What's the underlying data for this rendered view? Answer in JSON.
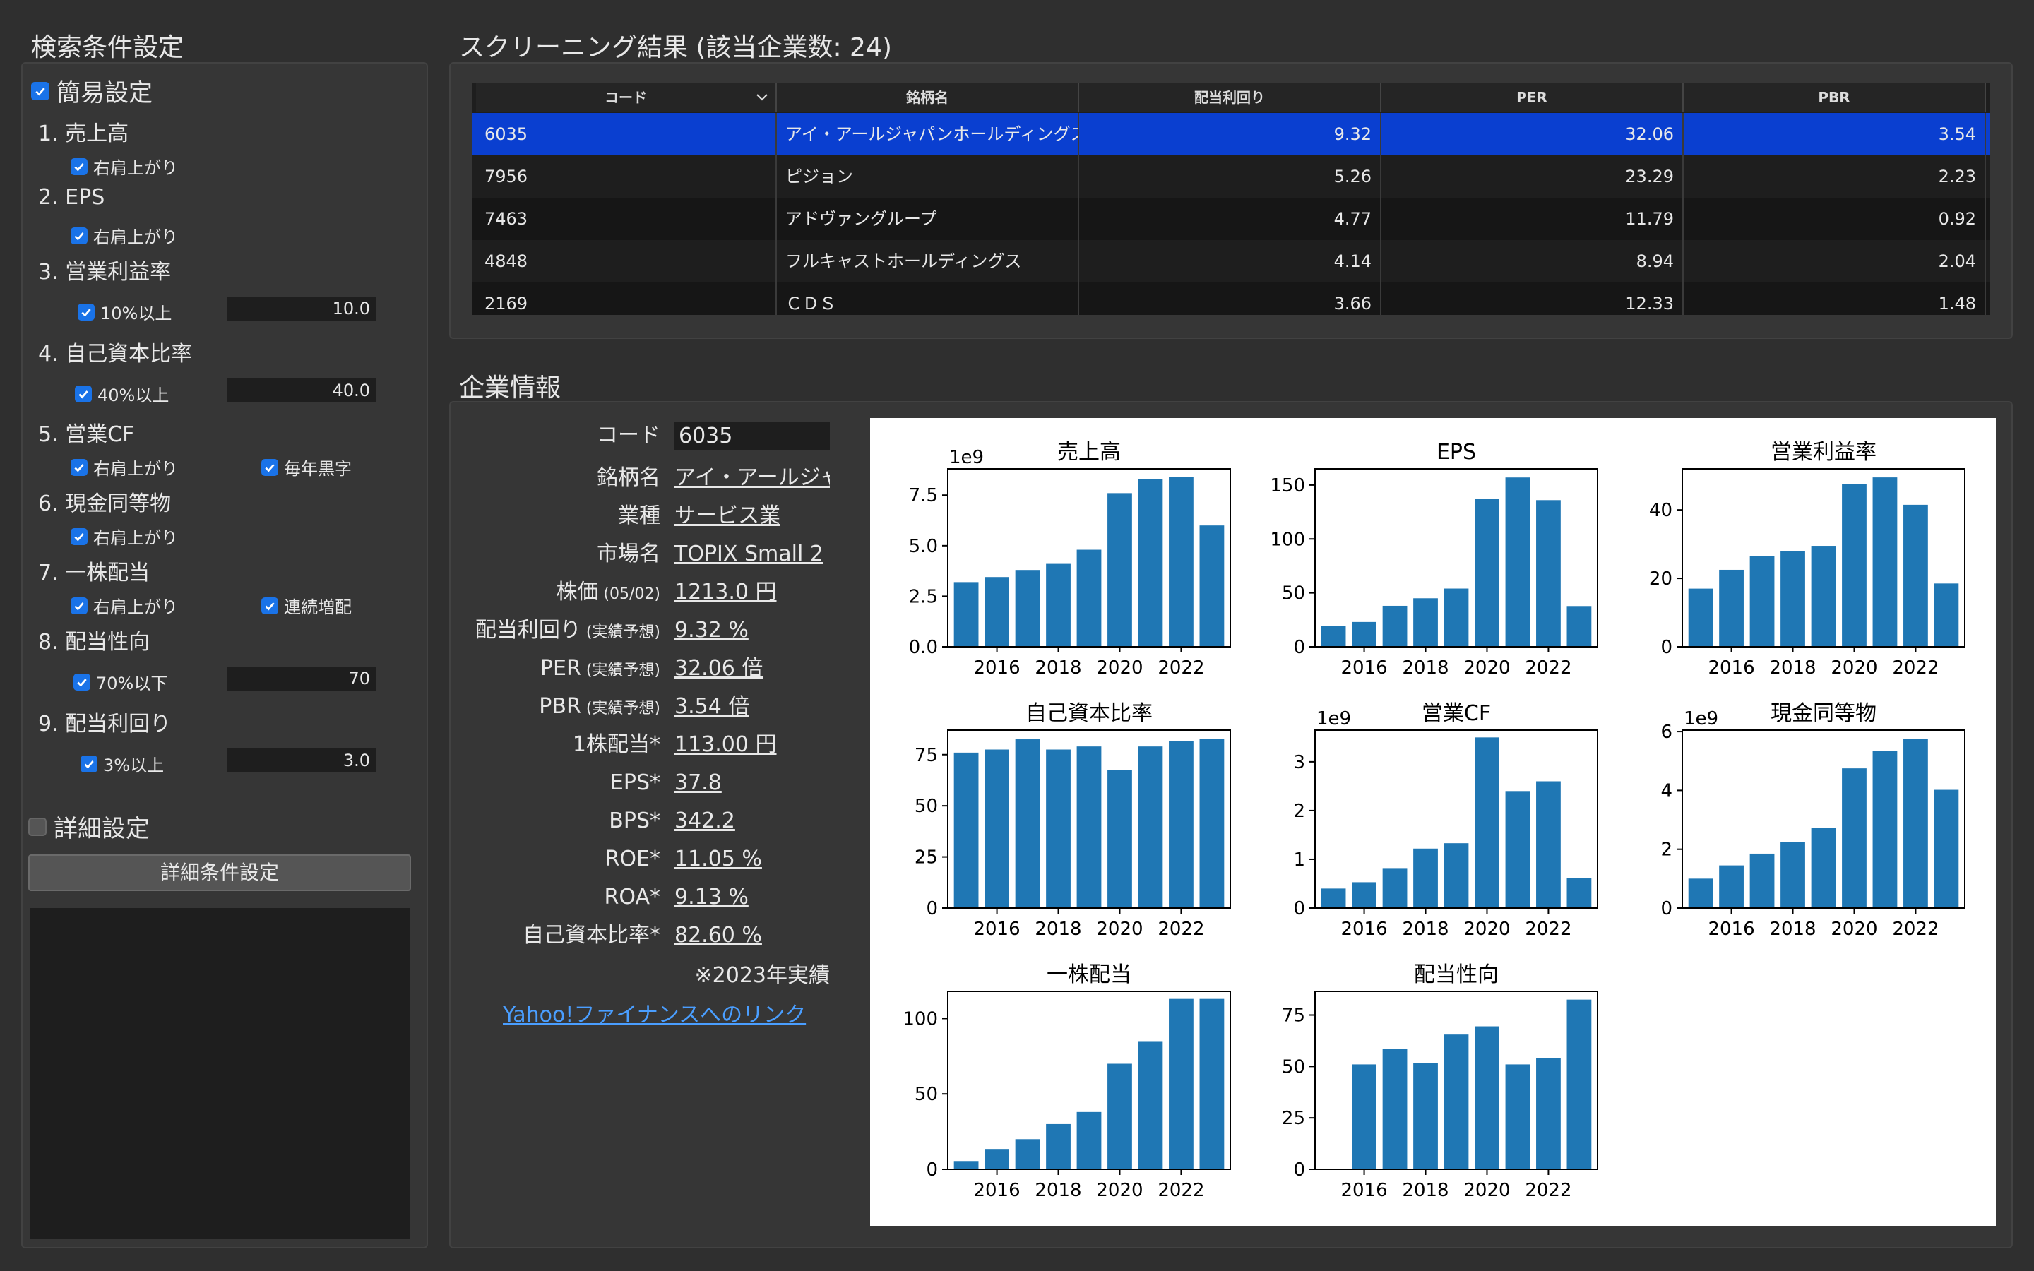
{
  "left": {
    "title": "検索条件設定",
    "simple": {
      "label": "簡易設定",
      "checked": true
    },
    "items": [
      {
        "head": "1. 売上高",
        "checks": [
          {
            "label": "右肩上がり"
          }
        ]
      },
      {
        "head": "2. EPS",
        "checks": [
          {
            "label": "右肩上がり"
          }
        ]
      },
      {
        "head": "3. 営業利益率",
        "checks": [
          {
            "label": "10%以上"
          }
        ],
        "value": "10.0"
      },
      {
        "head": "4. 自己資本比率",
        "checks": [
          {
            "label": "40%以上"
          }
        ],
        "value": "40.0"
      },
      {
        "head": "5. 営業CF",
        "checks": [
          {
            "label": "右肩上がり"
          },
          {
            "label": "毎年黒字"
          }
        ]
      },
      {
        "head": "6. 現金同等物",
        "checks": [
          {
            "label": "右肩上がり"
          }
        ]
      },
      {
        "head": "7. 一株配当",
        "checks": [
          {
            "label": "右肩上がり"
          },
          {
            "label": "連続増配"
          }
        ]
      },
      {
        "head": "8. 配当性向",
        "checks": [
          {
            "label": "70%以下"
          }
        ],
        "value": "70"
      },
      {
        "head": "9. 配当利回り",
        "checks": [
          {
            "label": "3%以上"
          }
        ],
        "value": "3.0"
      }
    ],
    "detail": {
      "label": "詳細設定",
      "checked": false
    },
    "detail_button": "詳細条件設定"
  },
  "results": {
    "title": "スクリーニング結果 (該当企業数: 24)",
    "columns": [
      "コード",
      "銘柄名",
      "配当利回り",
      "PER",
      "PBR"
    ],
    "rows": [
      [
        "6035",
        "アイ・アールジャパンホールディングス",
        "9.32",
        "32.06",
        "3.54"
      ],
      [
        "7956",
        "ピジョン",
        "5.26",
        "23.29",
        "2.23"
      ],
      [
        "7463",
        "アドヴァングループ",
        "4.77",
        "11.79",
        "0.92"
      ],
      [
        "4848",
        "フルキャストホールディングス",
        "4.14",
        "8.94",
        "2.04"
      ],
      [
        "2169",
        "ＣＤＳ",
        "3.66",
        "12.33",
        "1.48"
      ]
    ]
  },
  "company": {
    "title": "企業情報",
    "code_label": "コード",
    "code_value": "6035",
    "fields": [
      {
        "label": "銘柄名",
        "note": "",
        "value": "アイ・アールジャパンホールディングス"
      },
      {
        "label": "業種",
        "note": "",
        "value": "サービス業"
      },
      {
        "label": "市場名",
        "note": "",
        "value": "TOPIX Small 2"
      },
      {
        "label": "株価",
        "note": "(05/02)",
        "value": "1213.0 円"
      },
      {
        "label": "配当利回り",
        "note": "(実績予想)",
        "value": "9.32 %"
      },
      {
        "label": "PER",
        "note": "(実績予想)",
        "value": "32.06 倍"
      },
      {
        "label": "PBR",
        "note": "(実績予想)",
        "value": "3.54 倍"
      },
      {
        "label": "1株配当*",
        "note": "",
        "value": "113.00 円"
      },
      {
        "label": "EPS*",
        "note": "",
        "value": "37.8"
      },
      {
        "label": "BPS*",
        "note": "",
        "value": "342.2"
      },
      {
        "label": "ROE*",
        "note": "",
        "value": "11.05 %"
      },
      {
        "label": "ROA*",
        "note": "",
        "value": "9.13 %"
      },
      {
        "label": "自己資本比率*",
        "note": "",
        "value": "82.60 %"
      }
    ],
    "footnote": "※2023年実績",
    "link": "Yahoo!ファイナンスへのリンク",
    "colors": {
      "bar": "#1f77b4",
      "selected_row": "#0a3fd0",
      "accent": "#1a73e8",
      "link": "#4a9eff"
    }
  },
  "chart_data": [
    {
      "type": "bar",
      "title": "売上高",
      "x": [
        2015,
        2016,
        2017,
        2018,
        2019,
        2020,
        2021,
        2022,
        2023
      ],
      "values": [
        3.2,
        3.45,
        3.8,
        4.1,
        4.8,
        7.6,
        8.3,
        8.4,
        6.0
      ],
      "ylim": [
        0,
        8.8
      ],
      "yticks": [
        "0.0",
        "2.5",
        "5.0",
        "7.5"
      ],
      "ytick_values": [
        0,
        2.5,
        5.0,
        7.5
      ],
      "xticks": [
        "2016",
        "2018",
        "2020",
        "2022"
      ],
      "offset": "1e9"
    },
    {
      "type": "bar",
      "title": "EPS",
      "x": [
        2015,
        2016,
        2017,
        2018,
        2019,
        2020,
        2021,
        2022,
        2023
      ],
      "values": [
        19,
        23,
        38,
        45,
        54,
        137,
        157,
        136,
        37.8
      ],
      "ylim": [
        0,
        165
      ],
      "yticks": [
        "0",
        "50",
        "100",
        "150"
      ],
      "ytick_values": [
        0,
        50,
        100,
        150
      ],
      "xticks": [
        "2016",
        "2018",
        "2020",
        "2022"
      ],
      "offset": ""
    },
    {
      "type": "bar",
      "title": "営業利益率",
      "x": [
        2015,
        2016,
        2017,
        2018,
        2019,
        2020,
        2021,
        2022,
        2023
      ],
      "values": [
        17,
        22.5,
        26.5,
        28,
        29.5,
        47.5,
        49.5,
        41.5,
        18.5
      ],
      "ylim": [
        0,
        52
      ],
      "yticks": [
        "0",
        "20",
        "40"
      ],
      "ytick_values": [
        0,
        20,
        40
      ],
      "xticks": [
        "2016",
        "2018",
        "2020",
        "2022"
      ],
      "offset": ""
    },
    {
      "type": "bar",
      "title": "自己資本比率",
      "x": [
        2015,
        2016,
        2017,
        2018,
        2019,
        2020,
        2021,
        2022,
        2023
      ],
      "values": [
        76,
        77.5,
        82.5,
        77.5,
        79,
        67.5,
        79,
        81.5,
        82.6
      ],
      "ylim": [
        0,
        87
      ],
      "yticks": [
        "0",
        "25",
        "50",
        "75"
      ],
      "ytick_values": [
        0,
        25,
        50,
        75
      ],
      "xticks": [
        "2016",
        "2018",
        "2020",
        "2022"
      ],
      "offset": ""
    },
    {
      "type": "bar",
      "title": "営業CF",
      "x": [
        2015,
        2016,
        2017,
        2018,
        2019,
        2020,
        2021,
        2022,
        2023
      ],
      "values": [
        0.4,
        0.53,
        0.82,
        1.22,
        1.33,
        3.5,
        2.4,
        2.6,
        0.62
      ],
      "ylim": [
        0,
        3.65
      ],
      "yticks": [
        "0",
        "1",
        "2",
        "3"
      ],
      "ytick_values": [
        0,
        1,
        2,
        3
      ],
      "xticks": [
        "2016",
        "2018",
        "2020",
        "2022"
      ],
      "offset": "1e9"
    },
    {
      "type": "bar",
      "title": "現金同等物",
      "x": [
        2015,
        2016,
        2017,
        2018,
        2019,
        2020,
        2021,
        2022,
        2023
      ],
      "values": [
        1.0,
        1.45,
        1.85,
        2.25,
        2.72,
        4.75,
        5.35,
        5.75,
        4.02
      ],
      "ylim": [
        0,
        6.05
      ],
      "yticks": [
        "0",
        "2",
        "4",
        "6"
      ],
      "ytick_values": [
        0,
        2,
        4,
        6
      ],
      "xticks": [
        "2016",
        "2018",
        "2020",
        "2022"
      ],
      "offset": "1e9"
    },
    {
      "type": "bar",
      "title": "一株配当",
      "x": [
        2015,
        2016,
        2017,
        2018,
        2019,
        2020,
        2021,
        2022,
        2023
      ],
      "values": [
        5.5,
        13.5,
        20,
        30,
        38,
        70,
        85,
        113,
        113
      ],
      "ylim": [
        0,
        118
      ],
      "yticks": [
        "0",
        "50",
        "100"
      ],
      "ytick_values": [
        0,
        50,
        100
      ],
      "xticks": [
        "2016",
        "2018",
        "2020",
        "2022"
      ],
      "offset": ""
    },
    {
      "type": "bar",
      "title": "配当性向",
      "x": [
        2016,
        2017,
        2018,
        2019,
        2020,
        2021,
        2022,
        2023
      ],
      "values": [
        51,
        58.5,
        51.5,
        65.5,
        69.5,
        51,
        54,
        82.5
      ],
      "ylim": [
        0,
        86.5
      ],
      "yticks": [
        "0",
        "25",
        "50",
        "75"
      ],
      "ytick_values": [
        0,
        25,
        50,
        75
      ],
      "xticks": [
        "2016",
        "2018",
        "2020",
        "2022"
      ],
      "offset": ""
    }
  ]
}
